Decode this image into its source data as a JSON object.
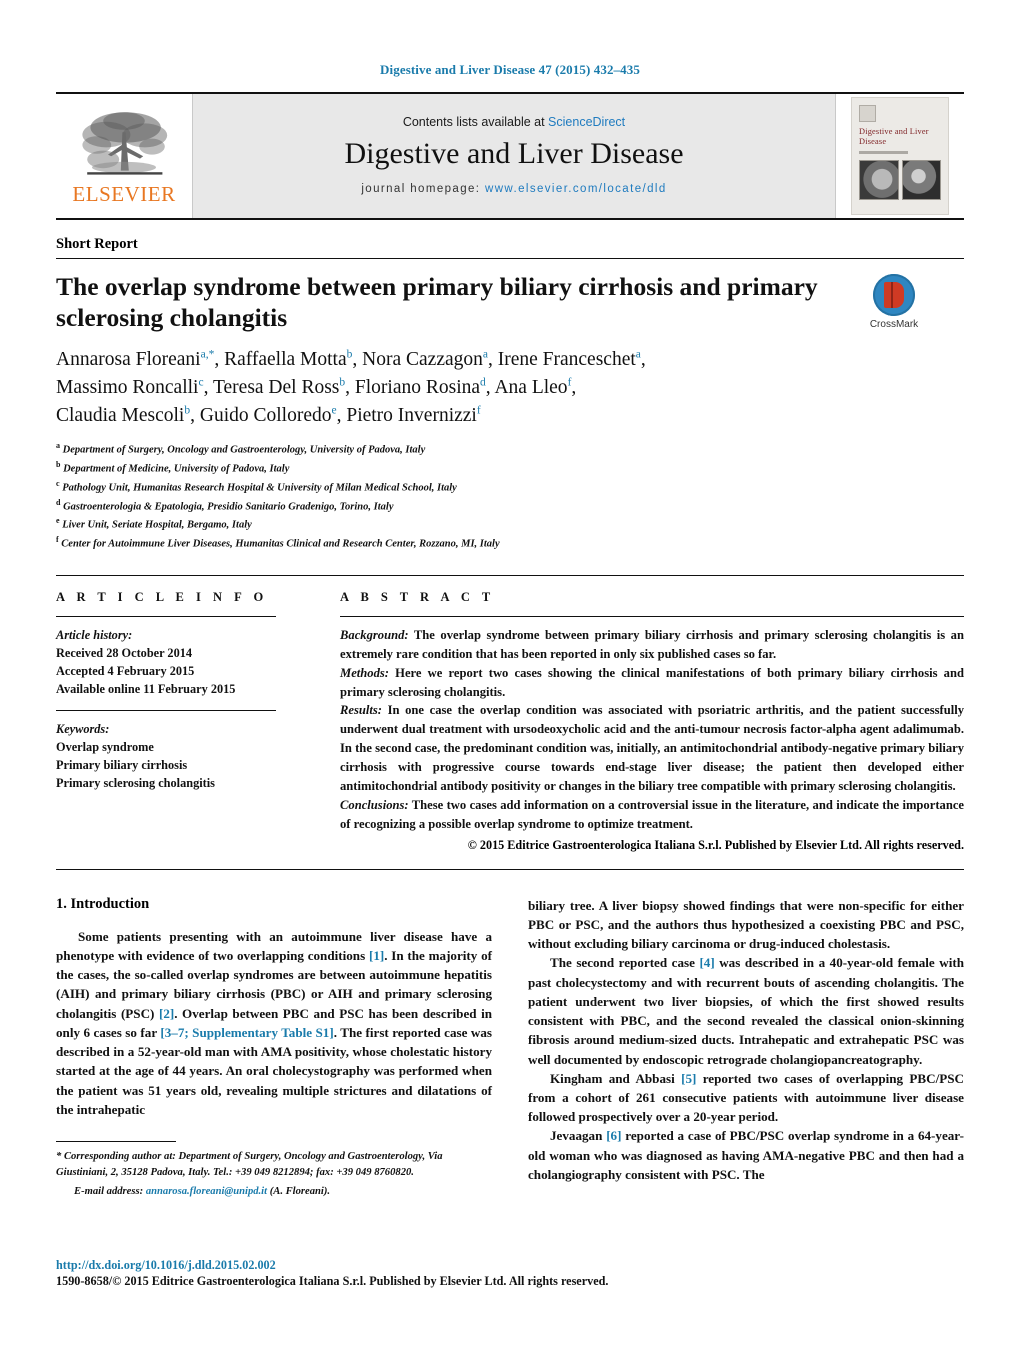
{
  "running_head": "Digestive and Liver Disease 47 (2015) 432–435",
  "masthead": {
    "publisher_logo_text": "ELSEVIER",
    "publisher_logo_icon": "elsevier-tree-icon",
    "contents_prefix": "Contents lists available at ",
    "contents_link": "ScienceDirect",
    "journal_title": "Digestive and Liver Disease",
    "homepage_label": "journal homepage: ",
    "homepage_url": "www.elsevier.com/locate/dld",
    "cover_title": "Digestive and Liver Disease",
    "cover_alt": "journal-cover-thumbnail"
  },
  "article": {
    "type_label": "Short Report",
    "title": "The overlap syndrome between primary biliary cirrhosis and primary sclerosing cholangitis",
    "crossmark_label": "CrossMark",
    "authors_lines": [
      "Annarosa Floreani<sup>a,*</sup>, Raffaella Motta<sup>b</sup>, Nora Cazzagon<sup>a</sup>, Irene Franceschet<sup>a</sup>,",
      "Massimo Roncalli<sup>c</sup>, Teresa Del Ross<sup>b</sup>, Floriano Rosina<sup>d</sup>, Ana Lleo<sup>f</sup>,",
      "Claudia Mescoli<sup>b</sup>, Guido Colloredo<sup>e</sup>, Pietro Invernizzi<sup>f</sup>"
    ],
    "affiliations": [
      {
        "mark": "a",
        "text": "Department of Surgery, Oncology and Gastroenterology, University of Padova, Italy"
      },
      {
        "mark": "b",
        "text": "Department of Medicine, University of Padova, Italy"
      },
      {
        "mark": "c",
        "text": "Pathology Unit, Humanitas Research Hospital & University of Milan Medical School, Italy"
      },
      {
        "mark": "d",
        "text": "Gastroenterologia & Epatologia, Presidio Sanitario Gradenigo, Torino, Italy"
      },
      {
        "mark": "e",
        "text": "Liver Unit, Seriate Hospital, Bergamo, Italy"
      },
      {
        "mark": "f",
        "text": "Center for Autoimmune Liver Diseases, Humanitas Clinical and Research Center, Rozzano, MI, Italy"
      }
    ]
  },
  "article_info": {
    "heading": "A R T I C L E   I N F O",
    "history_label": "Article history:",
    "history": [
      "Received 28 October 2014",
      "Accepted 4 February 2015",
      "Available online 11 February 2015"
    ],
    "keywords_label": "Keywords:",
    "keywords": [
      "Overlap syndrome",
      "Primary biliary cirrhosis",
      "Primary sclerosing cholangitis"
    ]
  },
  "abstract": {
    "heading": "A B S T R A C T",
    "sections": [
      {
        "lead": "Background:",
        "text": " The overlap syndrome between primary biliary cirrhosis and primary sclerosing cholangitis is an extremely rare condition that has been reported in only six published cases so far."
      },
      {
        "lead": "Methods:",
        "text": " Here we report two cases showing the clinical manifestations of both primary biliary cirrhosis and primary sclerosing cholangitis."
      },
      {
        "lead": "Results:",
        "text": " In one case the overlap condition was associated with psoriatric arthritis, and the patient successfully underwent dual treatment with ursodeoxycholic acid and the anti-tumour necrosis factor-alpha agent adalimumab. In the second case, the predominant condition was, initially, an antimitochondrial antibody-negative primary biliary cirrhosis with progressive course towards end-stage liver disease; the patient then developed either antimitochondrial antibody positivity or changes in the biliary tree compatible with primary sclerosing cholangitis."
      },
      {
        "lead": "Conclusions:",
        "text": " These two cases add information on a controversial issue in the literature, and indicate the importance of recognizing a possible overlap syndrome to optimize treatment."
      }
    ],
    "copyright": "© 2015 Editrice Gastroenterologica Italiana S.r.l. Published by Elsevier Ltd. All rights reserved."
  },
  "body": {
    "section_heading": "1.  Introduction",
    "left_paragraphs": [
      {
        "parts": [
          {
            "t": "Some patients presenting with an autoimmune liver disease have a phenotype with evidence of two overlapping conditions "
          },
          {
            "t": "[1]",
            "ref": true
          },
          {
            "t": ". In the majority of the cases, the so-called overlap syndromes are between autoimmune hepatitis (AIH) and primary biliary cirrhosis (PBC) or AIH and primary sclerosing cholangitis (PSC) "
          },
          {
            "t": "[2]",
            "ref": true
          },
          {
            "t": ". Overlap between PBC and PSC has been described in only 6 cases so far "
          },
          {
            "t": "[3–7; Supplementary Table S1]",
            "ref": true
          },
          {
            "t": ". The first reported case was described in a 52-year-old man with AMA positivity, whose cholestatic history started at the age of 44 years. An oral cholecystography was performed when the patient was 51 years old, revealing multiple strictures and dilatations of the intrahepatic"
          }
        ]
      }
    ],
    "right_paragraphs": [
      {
        "indent": false,
        "parts": [
          {
            "t": "biliary tree. A liver biopsy showed findings that were non-specific for either PBC or PSC, and the authors thus hypothesized a coexisting PBC and PSC, without excluding biliary carcinoma or drug-induced cholestasis."
          }
        ]
      },
      {
        "indent": true,
        "parts": [
          {
            "t": "The second reported case "
          },
          {
            "t": "[4]",
            "ref": true
          },
          {
            "t": " was described in a 40-year-old female with past cholecystectomy and with recurrent bouts of ascending cholangitis. The patient underwent two liver biopsies, of which the first showed results consistent with PBC, and the second revealed the classical onion-skinning fibrosis around medium-sized ducts. Intrahepatic and extrahepatic PSC was well documented by endoscopic retrograde cholangiopancreatography."
          }
        ]
      },
      {
        "indent": true,
        "parts": [
          {
            "t": "Kingham and Abbasi "
          },
          {
            "t": "[5]",
            "ref": true
          },
          {
            "t": " reported two cases of overlapping PBC/PSC from a cohort of 261 consecutive patients with autoimmune liver disease followed prospectively over a 20-year period."
          }
        ]
      },
      {
        "indent": true,
        "parts": [
          {
            "t": "Jevaagan "
          },
          {
            "t": "[6]",
            "ref": true
          },
          {
            "t": " reported a case of PBC/PSC overlap syndrome in a 64-year-old woman who was diagnosed as having AMA-negative PBC and then had a cholangiography consistent with PSC. The"
          }
        ]
      }
    ]
  },
  "footnote": {
    "corresponding": "* Corresponding author at: Department of Surgery, Oncology and Gastroenterology, Via Giustiniani, 2, 35128 Padova, Italy. Tel.: +39 049 8212894; fax: +39 049 8760820.",
    "email_label": "E-mail address:",
    "email": "annarosa.floreani@unipd.it",
    "email_suffix": " (A. Floreani)."
  },
  "footer": {
    "doi": "http://dx.doi.org/10.1016/j.dld.2015.02.002",
    "issn_line": "1590-8658/© 2015 Editrice Gastroenterologica Italiana S.r.l. Published by Elsevier Ltd. All rights reserved."
  },
  "colors": {
    "link": "#1a7bab",
    "elsevier_orange": "#e87722",
    "crossmark_blue": "#2e86c1",
    "crossmark_red": "#cf3a24"
  }
}
